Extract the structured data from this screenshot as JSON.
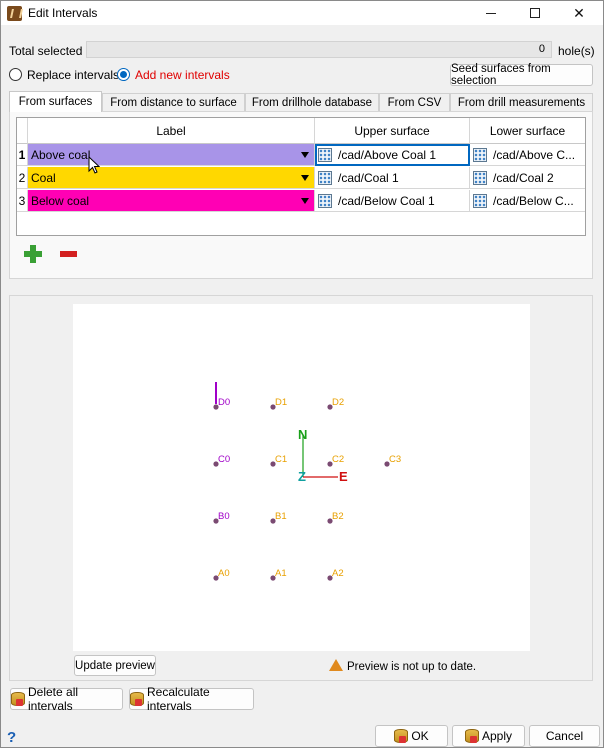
{
  "window": {
    "title": "Edit Intervals"
  },
  "summary": {
    "total_label": "Total selected",
    "count": "0",
    "unit": "hole(s)"
  },
  "mode": {
    "replace_label": "Replace intervals",
    "add_label": "Add new intervals",
    "add_color": "#e00000",
    "selected": "add"
  },
  "seed_button": "Seed surfaces from selection",
  "tabs": [
    {
      "label": "From surfaces",
      "active": true
    },
    {
      "label": "From distance to surface",
      "active": false
    },
    {
      "label": "From drillhole database",
      "active": false
    },
    {
      "label": "From CSV",
      "active": false
    },
    {
      "label": "From drill measurements",
      "active": false
    }
  ],
  "grid": {
    "headers": [
      "Label",
      "Upper surface",
      "Lower surface"
    ],
    "rows": [
      {
        "num": "1",
        "label": "Above coal",
        "color": "#a894e8",
        "upper": "/cad/Above Coal 1",
        "lower": "/cad/Above C..."
      },
      {
        "num": "2",
        "label": "Coal",
        "color": "#ffd800",
        "upper": "/cad/Coal 1",
        "lower": "/cad/Coal 2"
      },
      {
        "num": "3",
        "label": "Below coal",
        "color": "#ff00b4",
        "upper": "/cad/Below Coal 1",
        "lower": "/cad/Below C..."
      }
    ]
  },
  "preview": {
    "holes": [
      {
        "id": "D0",
        "color": "#a000c8"
      },
      {
        "id": "D1",
        "color": "#e8a000"
      },
      {
        "id": "D2",
        "color": "#e8a000"
      },
      {
        "id": "C0",
        "color": "#a000c8"
      },
      {
        "id": "C1",
        "color": "#e8a000"
      },
      {
        "id": "C2",
        "color": "#e8a000"
      },
      {
        "id": "C3",
        "color": "#e8a000"
      },
      {
        "id": "B0",
        "color": "#a000c8"
      },
      {
        "id": "B1",
        "color": "#e8a000"
      },
      {
        "id": "B2",
        "color": "#e8a000"
      },
      {
        "id": "A0",
        "color": "#e8a000"
      },
      {
        "id": "A1",
        "color": "#e8a000"
      },
      {
        "id": "A2",
        "color": "#e8a000"
      }
    ],
    "axis": {
      "n": "N",
      "e": "E",
      "z": "Z",
      "n_color": "#1aa01a",
      "e_color": "#d01010",
      "z_color": "#10a0a0"
    },
    "update_button": "Update preview",
    "status": "Preview is not up to date."
  },
  "actions": {
    "delete_all": "Delete all intervals",
    "recalc": "Recalculate intervals"
  },
  "footer": {
    "help": "?",
    "ok": "OK",
    "apply": "Apply",
    "cancel": "Cancel"
  }
}
